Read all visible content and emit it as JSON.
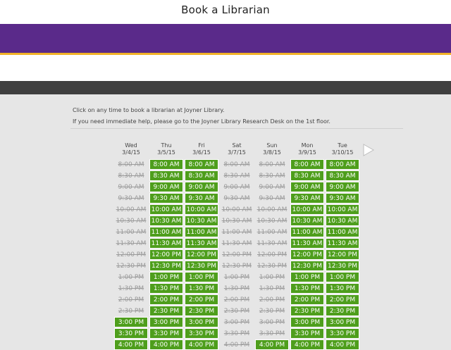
{
  "header": {
    "title": "Book a Librarian"
  },
  "intro": {
    "line1": "Click on any time to book a librarian at Joyner Library.",
    "line2": "If you need immediate help, please go to the Joyner Library Research Desk on the 1st floor."
  },
  "next_icon": "next-arrow-icon",
  "colors": {
    "available": "#4e9e1c",
    "brand_purple": "#5a2a8a",
    "brand_gold": "#f2b228"
  },
  "days": [
    {
      "day": "Wed",
      "date": "3/4/15",
      "slots": [
        {
          "time": "8:00 AM",
          "available": false
        },
        {
          "time": "8:30 AM",
          "available": false
        },
        {
          "time": "9:00 AM",
          "available": false
        },
        {
          "time": "9:30 AM",
          "available": false
        },
        {
          "time": "10:00 AM",
          "available": false
        },
        {
          "time": "10:30 AM",
          "available": false
        },
        {
          "time": "11:00 AM",
          "available": false
        },
        {
          "time": "11:30 AM",
          "available": false
        },
        {
          "time": "12:00 PM",
          "available": false
        },
        {
          "time": "12:30 PM",
          "available": false
        },
        {
          "time": "1:00 PM",
          "available": false
        },
        {
          "time": "1:30 PM",
          "available": false
        },
        {
          "time": "2:00 PM",
          "available": false
        },
        {
          "time": "2:30 PM",
          "available": false
        },
        {
          "time": "3:00 PM",
          "available": true
        },
        {
          "time": "3:30 PM",
          "available": true
        },
        {
          "time": "4:00 PM",
          "available": true
        }
      ]
    },
    {
      "day": "Thu",
      "date": "3/5/15",
      "slots": [
        {
          "time": "8:00 AM",
          "available": true
        },
        {
          "time": "8:30 AM",
          "available": true
        },
        {
          "time": "9:00 AM",
          "available": true
        },
        {
          "time": "9:30 AM",
          "available": true
        },
        {
          "time": "10:00 AM",
          "available": true
        },
        {
          "time": "10:30 AM",
          "available": true
        },
        {
          "time": "11:00 AM",
          "available": true
        },
        {
          "time": "11:30 AM",
          "available": true
        },
        {
          "time": "12:00 PM",
          "available": true
        },
        {
          "time": "12:30 PM",
          "available": true
        },
        {
          "time": "1:00 PM",
          "available": true
        },
        {
          "time": "1:30 PM",
          "available": true
        },
        {
          "time": "2:00 PM",
          "available": true
        },
        {
          "time": "2:30 PM",
          "available": true
        },
        {
          "time": "3:00 PM",
          "available": true
        },
        {
          "time": "3:30 PM",
          "available": true
        },
        {
          "time": "4:00 PM",
          "available": true
        }
      ]
    },
    {
      "day": "Fri",
      "date": "3/6/15",
      "slots": [
        {
          "time": "8:00 AM",
          "available": true
        },
        {
          "time": "8:30 AM",
          "available": true
        },
        {
          "time": "9:00 AM",
          "available": true
        },
        {
          "time": "9:30 AM",
          "available": true
        },
        {
          "time": "10:00 AM",
          "available": true
        },
        {
          "time": "10:30 AM",
          "available": true
        },
        {
          "time": "11:00 AM",
          "available": true
        },
        {
          "time": "11:30 AM",
          "available": true
        },
        {
          "time": "12:00 PM",
          "available": true
        },
        {
          "time": "12:30 PM",
          "available": true
        },
        {
          "time": "1:00 PM",
          "available": true
        },
        {
          "time": "1:30 PM",
          "available": true
        },
        {
          "time": "2:00 PM",
          "available": true
        },
        {
          "time": "2:30 PM",
          "available": true
        },
        {
          "time": "3:00 PM",
          "available": true
        },
        {
          "time": "3:30 PM",
          "available": true
        },
        {
          "time": "4:00 PM",
          "available": true
        }
      ]
    },
    {
      "day": "Sat",
      "date": "3/7/15",
      "slots": [
        {
          "time": "8:00 AM",
          "available": false
        },
        {
          "time": "8:30 AM",
          "available": false
        },
        {
          "time": "9:00 AM",
          "available": false
        },
        {
          "time": "9:30 AM",
          "available": false
        },
        {
          "time": "10:00 AM",
          "available": false
        },
        {
          "time": "10:30 AM",
          "available": false
        },
        {
          "time": "11:00 AM",
          "available": false
        },
        {
          "time": "11:30 AM",
          "available": false
        },
        {
          "time": "12:00 PM",
          "available": false
        },
        {
          "time": "12:30 PM",
          "available": false
        },
        {
          "time": "1:00 PM",
          "available": false
        },
        {
          "time": "1:30 PM",
          "available": false
        },
        {
          "time": "2:00 PM",
          "available": false
        },
        {
          "time": "2:30 PM",
          "available": false
        },
        {
          "time": "3:00 PM",
          "available": false
        },
        {
          "time": "3:30 PM",
          "available": false
        },
        {
          "time": "4:00 PM",
          "available": false
        }
      ]
    },
    {
      "day": "Sun",
      "date": "3/8/15",
      "slots": [
        {
          "time": "8:00 AM",
          "available": false
        },
        {
          "time": "8:30 AM",
          "available": false
        },
        {
          "time": "9:00 AM",
          "available": false
        },
        {
          "time": "9:30 AM",
          "available": false
        },
        {
          "time": "10:00 AM",
          "available": false
        },
        {
          "time": "10:30 AM",
          "available": false
        },
        {
          "time": "11:00 AM",
          "available": false
        },
        {
          "time": "11:30 AM",
          "available": false
        },
        {
          "time": "12:00 PM",
          "available": false
        },
        {
          "time": "12:30 PM",
          "available": false
        },
        {
          "time": "1:00 PM",
          "available": false
        },
        {
          "time": "1:30 PM",
          "available": false
        },
        {
          "time": "2:00 PM",
          "available": false
        },
        {
          "time": "2:30 PM",
          "available": false
        },
        {
          "time": "3:00 PM",
          "available": false
        },
        {
          "time": "3:30 PM",
          "available": false
        },
        {
          "time": "4:00 PM",
          "available": true
        }
      ]
    },
    {
      "day": "Mon",
      "date": "3/9/15",
      "slots": [
        {
          "time": "8:00 AM",
          "available": true
        },
        {
          "time": "8:30 AM",
          "available": true
        },
        {
          "time": "9:00 AM",
          "available": true
        },
        {
          "time": "9:30 AM",
          "available": true
        },
        {
          "time": "10:00 AM",
          "available": true
        },
        {
          "time": "10:30 AM",
          "available": true
        },
        {
          "time": "11:00 AM",
          "available": true
        },
        {
          "time": "11:30 AM",
          "available": true
        },
        {
          "time": "12:00 PM",
          "available": true
        },
        {
          "time": "12:30 PM",
          "available": true
        },
        {
          "time": "1:00 PM",
          "available": true
        },
        {
          "time": "1:30 PM",
          "available": true
        },
        {
          "time": "2:00 PM",
          "available": true
        },
        {
          "time": "2:30 PM",
          "available": true
        },
        {
          "time": "3:00 PM",
          "available": true
        },
        {
          "time": "3:30 PM",
          "available": true
        },
        {
          "time": "4:00 PM",
          "available": true
        }
      ]
    },
    {
      "day": "Tue",
      "date": "3/10/15",
      "slots": [
        {
          "time": "8:00 AM",
          "available": true
        },
        {
          "time": "8:30 AM",
          "available": true
        },
        {
          "time": "9:00 AM",
          "available": true
        },
        {
          "time": "9:30 AM",
          "available": true
        },
        {
          "time": "10:00 AM",
          "available": true
        },
        {
          "time": "10:30 AM",
          "available": true
        },
        {
          "time": "11:00 AM",
          "available": true
        },
        {
          "time": "11:30 AM",
          "available": true
        },
        {
          "time": "12:00 PM",
          "available": true
        },
        {
          "time": "12:30 PM",
          "available": true
        },
        {
          "time": "1:00 PM",
          "available": true
        },
        {
          "time": "1:30 PM",
          "available": true
        },
        {
          "time": "2:00 PM",
          "available": true
        },
        {
          "time": "2:30 PM",
          "available": true
        },
        {
          "time": "3:00 PM",
          "available": true
        },
        {
          "time": "3:30 PM",
          "available": true
        },
        {
          "time": "4:00 PM",
          "available": true
        }
      ]
    }
  ]
}
